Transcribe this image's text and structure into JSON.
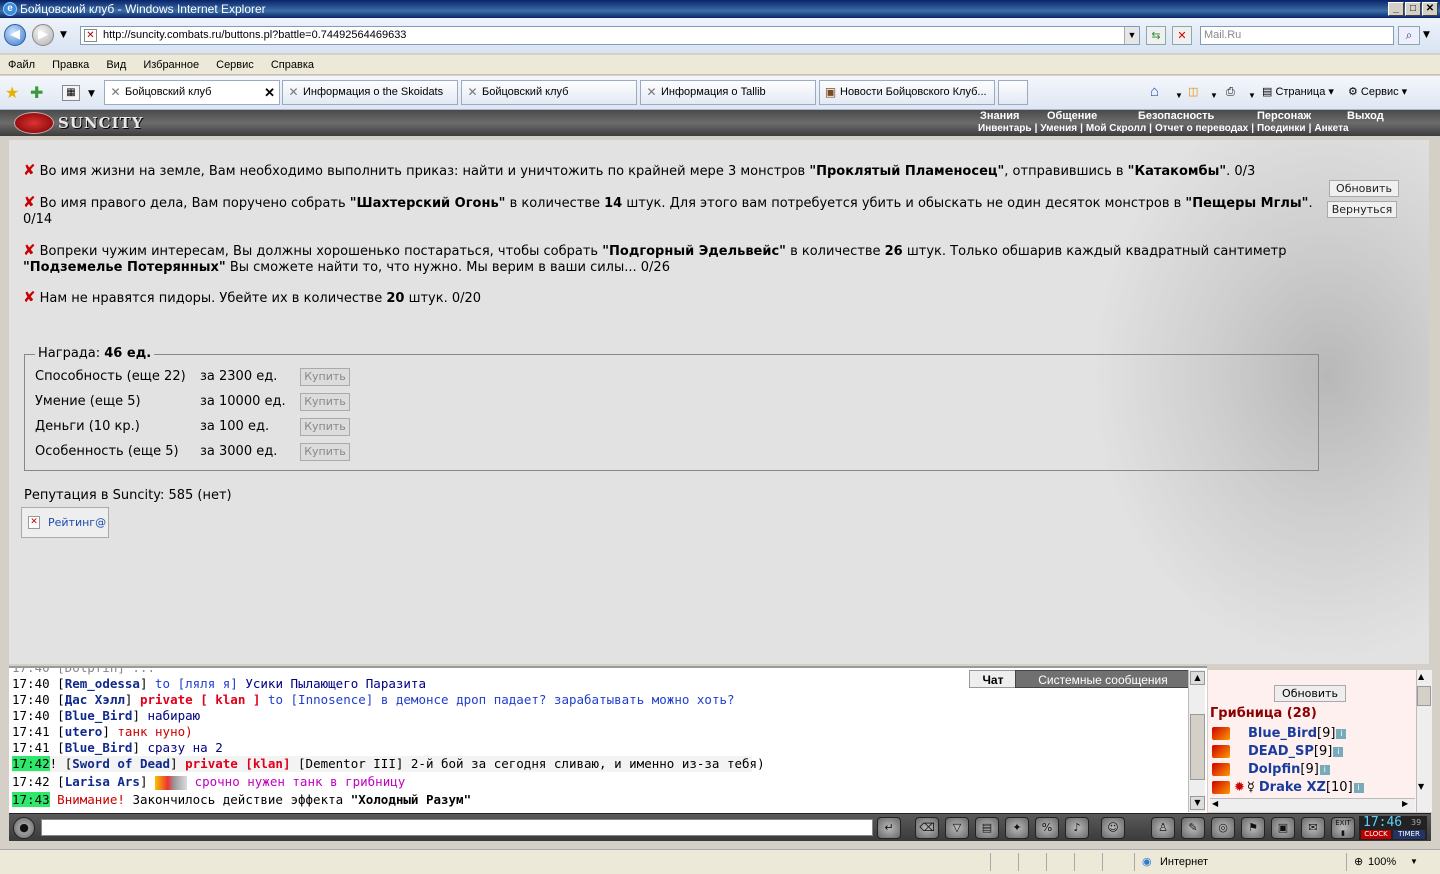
{
  "window": {
    "title": "Бойцовский клуб - Windows Internet Explorer",
    "min": "_",
    "max": "□",
    "close": "✕"
  },
  "address": {
    "url": "http://suncity.combats.ru/buttons.pl?battle=0.74492564469633",
    "search_placeholder": "Mail.Ru"
  },
  "menu": [
    "Файл",
    "Правка",
    "Вид",
    "Избранное",
    "Сервис",
    "Справка"
  ],
  "tabs": [
    {
      "label": "Бойцовский клуб",
      "active": true
    },
    {
      "label": "Информация о the Skoidats"
    },
    {
      "label": "Бойцовский клуб"
    },
    {
      "label": "Информация о Tallib"
    },
    {
      "label": "Новости Бойцовского Клуб..."
    }
  ],
  "commandbar": {
    "page": "Страница",
    "tools": "Сервис"
  },
  "game": {
    "logo": "SUNCITY",
    "menu_top": [
      "Знания",
      "Общение",
      "Безопасность",
      "Персонаж",
      "Выход"
    ],
    "menu_bottom": [
      "Инвентарь",
      "Умения",
      "Мой Скролл",
      "Отчет о переводах",
      "Поединки",
      "Анкета"
    ]
  },
  "quests": {
    "q1": {
      "a": "Во имя жизни на земле, Вам необходимо выполнить приказ: найти и уничтожить по крайней мере 3 монстров ",
      "b": "\"Проклятый Пламеносец\"",
      "c": ", отправившись в ",
      "d": "\"Катакомбы\"",
      "e": ". 0/3"
    },
    "q2": {
      "a": "Во имя правого дела, Вам поручено собрать ",
      "b": "\"Шахтерский Огонь\"",
      "c": " в количестве ",
      "d": "14",
      "e": " штук. Для этого вам потребуется убить и обыскать не один десяток монстров в ",
      "f": "\"Пещеры Мглы\"",
      "g": ".",
      "h": "0/14"
    },
    "q3": {
      "a": "Вопреки чужим интересам, Вы должны хорошенько постараться, чтобы собрать ",
      "b": "\"Подгорный Эдельвейс\"",
      "c": " в количестве ",
      "d": "26",
      "e": " штук. Только обшарив каждый квадратный сантиметр",
      "f": "\"Подземелье Потерянных\"",
      "g": " Вы сможете найти то, что нужно. Мы верим в ваши силы... 0/26"
    },
    "q4": {
      "a": "Нам не нравятся пидоры. Убейте их в количестве ",
      "b": "20",
      "c": " штук. 0/20"
    },
    "refresh": "Обновить",
    "back": "Вернуться"
  },
  "reward": {
    "label": "Награда:",
    "amount": "46 ед.",
    "rows": [
      {
        "name": "Способность (еще 22)",
        "price": "за 2300 ед.",
        "btn": "Купить"
      },
      {
        "name": "Умение (еще 5)",
        "price": "за 10000 ед.",
        "btn": "Купить"
      },
      {
        "name": "Деньги (10 кр.)",
        "price": "за 100 ед.",
        "btn": "Купить"
      },
      {
        "name": "Особенность (еще 5)",
        "price": "за 3000 ед.",
        "btn": "Купить"
      }
    ]
  },
  "reputation": "Репутация в Suncity: 585 (нет)",
  "rating": "Рейтинг@",
  "chat": {
    "tab_chat": "Чат",
    "tab_system": "Системные сообщения",
    "lines": [
      {
        "time": "17:40",
        "nick": "Rem_odessa",
        "to": "to [ляля я]",
        "text": "Усики Пылающего Паразита"
      },
      {
        "time": "17:40",
        "nick": "Дас Хэлл",
        "private": "private [ klan ]",
        "to": "to [Innosence]",
        "text": "в демонсе дроп падает? зарабатывать можно хоть?"
      },
      {
        "time": "17:40",
        "nick": "Blue_Bird",
        "text": "набираю"
      },
      {
        "time": "17:41",
        "nick": "utero",
        "text": "танк нуно)"
      },
      {
        "time": "17:41",
        "nick": "Blue_Bird",
        "text": "сразу на 2"
      },
      {
        "time": "17:42",
        "nick": "Sword of Dead",
        "private": "private [klan]",
        "to": "[Dementor III]",
        "text": "2-й бой за сегодня сливаю, и именно из-за тебя)"
      },
      {
        "time": "17:42",
        "nick": "Larisa Ars",
        "text": "срочно нужен танк в грибницу"
      },
      {
        "time": "17:43",
        "alert": "Внимание!",
        "text": "Закончилось действие эффекта ",
        "bold": "\"Холодный Разум\""
      }
    ]
  },
  "online": {
    "refresh": "Обновить",
    "room": "Грибница (28)",
    "users": [
      {
        "name": "Blue_Bird",
        "level": "[9]"
      },
      {
        "name": "DEAD_SP",
        "level": "[9]"
      },
      {
        "name": "Dolpfin",
        "level": "[9]"
      },
      {
        "name": "Drake XZ",
        "level": "[10]"
      }
    ]
  },
  "clock": {
    "time": "17:46",
    "sec": "39",
    "clock": "CLOCK",
    "timer": "TIMER",
    "exit": "EXIT"
  },
  "status": {
    "zone": "Интернет",
    "zoom": "100%"
  }
}
